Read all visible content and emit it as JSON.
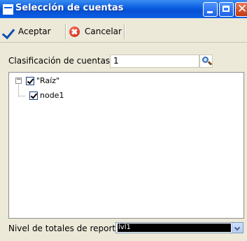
{
  "window": {
    "title": "Selección de cuentas"
  },
  "toolbar": {
    "accept_label": "Aceptar",
    "cancel_label": "Cancelar"
  },
  "form": {
    "account_classification_label": "Clasificación de cuentas",
    "account_classification_value": "1",
    "report_totals_level_label": "Nivel de totales de reporte",
    "report_totals_level_value": "lvl1"
  },
  "tree": {
    "nodes": [
      {
        "label": "\"Raíz\"",
        "checked": true,
        "expanded": true
      },
      {
        "label": "node1",
        "checked": true
      }
    ]
  },
  "icons": {
    "accept": "checkmark-icon",
    "cancel": "cancel-icon",
    "search": "search-icon"
  },
  "colors": {
    "titlebar": "#0a5de0",
    "close_button": "#c1380f"
  }
}
